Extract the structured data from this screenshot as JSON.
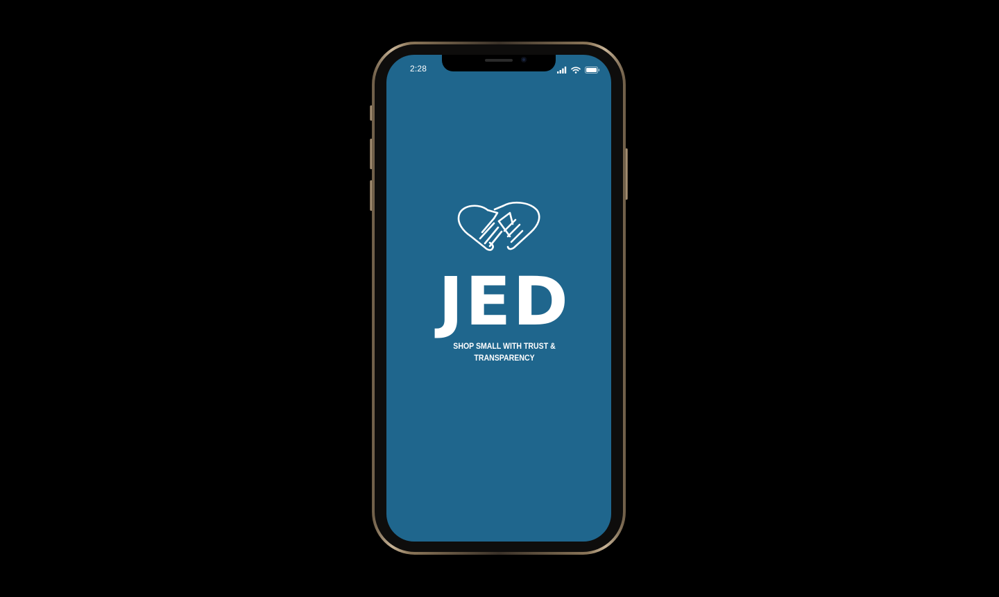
{
  "status_bar": {
    "time": "2:28",
    "icons": [
      "cellular-signal-icon",
      "wifi-icon",
      "battery-icon"
    ]
  },
  "splash": {
    "logo_icon": "heart-hands-icon",
    "brand_name": "JED",
    "tagline_line1": "SHOP SMALL WITH TRUST &",
    "tagline_line2": "TRANSPARENCY"
  },
  "colors": {
    "screen_background": "#1f668d",
    "page_background": "#000000",
    "foreground": "#ffffff",
    "frame": "#c8b497"
  }
}
